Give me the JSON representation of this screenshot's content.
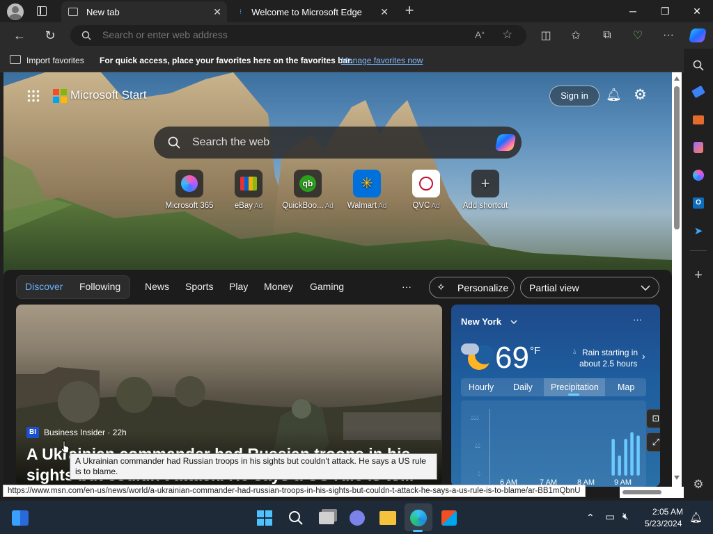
{
  "titlebar": {
    "tabs": [
      {
        "label": "New tab",
        "active": true
      },
      {
        "label": "Welcome to Microsoft Edge",
        "active": false
      }
    ],
    "minimize": "─",
    "restore": "❐",
    "close": "✕"
  },
  "toolbar": {
    "address_placeholder": "Search or enter web address"
  },
  "favorites_bar": {
    "import_label": "Import favorites",
    "hint": "For quick access, place your favorites here on the favorites bar.",
    "manage_link": "Manage favorites now"
  },
  "start": {
    "brand": "Microsoft Start",
    "sign_in": "Sign in",
    "search_placeholder": "Search the web",
    "shortcuts": [
      {
        "label": "Microsoft 365",
        "ad": ""
      },
      {
        "label": "eBay",
        "ad": "Ad"
      },
      {
        "label": "QuickBoo...",
        "ad": "Ad"
      },
      {
        "label": "Walmart",
        "ad": "Ad"
      },
      {
        "label": "QVC",
        "ad": "Ad"
      },
      {
        "label": "Add shortcut",
        "ad": ""
      }
    ]
  },
  "feed_nav": {
    "discover": "Discover",
    "following": "Following",
    "items": [
      "News",
      "Sports",
      "Play",
      "Money",
      "Gaming"
    ],
    "more": "···",
    "personalize": "Personalize",
    "view": "Partial view"
  },
  "article": {
    "source_badge": "BI",
    "source": "Business Insider · 22h",
    "headline_line1": "A Ukrainian commander had Russian troops in his",
    "headline_line2": "sights but couldn't attack. He says a US rule is to...",
    "tooltip": "A Ukrainian commander had Russian troops in his sights but couldn't attack. He says a US rule is to blame."
  },
  "weather": {
    "city": "New York",
    "temp": "69",
    "unit": "°F",
    "rain_line1": "Rain starting in",
    "rain_line2": "about 2.5 hours",
    "tabs": [
      "Hourly",
      "Daily",
      "Precipitation",
      "Map"
    ],
    "active_tab": "Precipitation",
    "x_labels": [
      "6 AM",
      "7 AM",
      "8 AM",
      "9 AM"
    ],
    "precip_bars": [
      0,
      0,
      0,
      0,
      0,
      0,
      0,
      0,
      0,
      0,
      0,
      0,
      0,
      0,
      0,
      0,
      0,
      0,
      0,
      0.55,
      0.3,
      0.55,
      0.65,
      0.6
    ]
  },
  "status_url": "https://www.msn.com/en-us/news/world/a-ukrainian-commander-had-russian-troops-in-his-sights-but-couldn-t-attack-he-says-a-us-rule-is-to-blame/ar-BB1mQbnU",
  "taskbar": {
    "time": "2:05 AM",
    "date": "5/23/2024"
  },
  "colors": {
    "accent": "#4aa3ff",
    "link": "#7ab8ff",
    "taskbar": "#1f2a38"
  }
}
